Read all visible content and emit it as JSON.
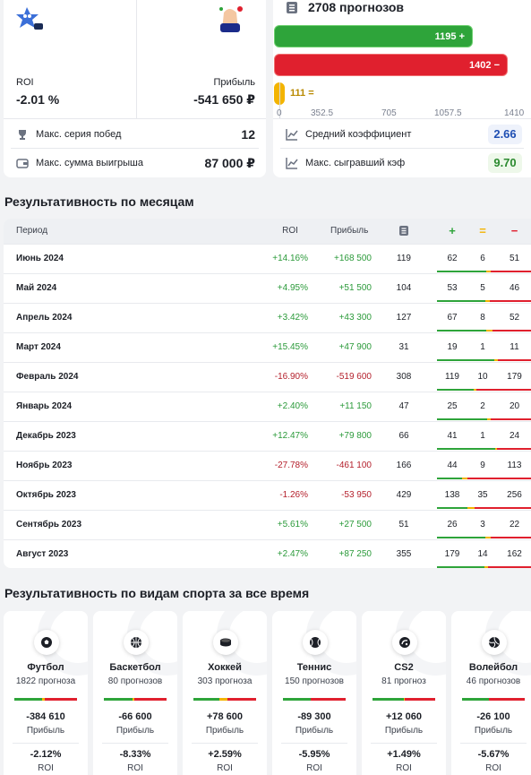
{
  "summary": {
    "roi_label": "ROI",
    "roi_value": "-2.01 %",
    "profit_label": "Прибыль",
    "profit_value": "-541 650 ₽",
    "max_win_streak_label": "Макс. серия побед",
    "max_win_streak_value": "12",
    "max_win_sum_label": "Макс. сумма выигрыша",
    "max_win_sum_value": "87 000 ₽"
  },
  "forecasts": {
    "title": "2708 прогнозов",
    "wins": "1195",
    "wins_sign": "+",
    "losses": "1402",
    "losses_sign": "−",
    "draws": "111",
    "draws_sign": "=",
    "scale_max": 1410,
    "ticks": [
      "0",
      "352.5",
      "705",
      "1057.5",
      "1410"
    ],
    "avg_coef_label": "Средний коэффициент",
    "avg_coef_value": "2.66",
    "max_coef_label": "Макс. сыгравший кэф",
    "max_coef_value": "9.70"
  },
  "months": {
    "title": "Результативность по месяцам",
    "headers": {
      "period": "Период",
      "roi": "ROI",
      "profit": "Прибыль"
    },
    "rows": [
      {
        "period": "Июнь 2024",
        "roi": "+14.16%",
        "profit": "+168 500",
        "n": "119",
        "w": "62",
        "d": "6",
        "l": "51",
        "positive": true
      },
      {
        "period": "Май 2024",
        "roi": "+4.95%",
        "profit": "+51 500",
        "n": "104",
        "w": "53",
        "d": "5",
        "l": "46",
        "positive": true
      },
      {
        "period": "Апрель 2024",
        "roi": "+3.42%",
        "profit": "+43 300",
        "n": "127",
        "w": "67",
        "d": "8",
        "l": "52",
        "positive": true
      },
      {
        "period": "Март 2024",
        "roi": "+15.45%",
        "profit": "+47 900",
        "n": "31",
        "w": "19",
        "d": "1",
        "l": "11",
        "positive": true
      },
      {
        "period": "Февраль 2024",
        "roi": "-16.90%",
        "profit": "-519 600",
        "n": "308",
        "w": "119",
        "d": "10",
        "l": "179",
        "positive": false
      },
      {
        "period": "Январь 2024",
        "roi": "+2.40%",
        "profit": "+11 150",
        "n": "47",
        "w": "25",
        "d": "2",
        "l": "20",
        "positive": true
      },
      {
        "period": "Декабрь 2023",
        "roi": "+12.47%",
        "profit": "+79 800",
        "n": "66",
        "w": "41",
        "d": "1",
        "l": "24",
        "positive": true
      },
      {
        "period": "Ноябрь 2023",
        "roi": "-27.78%",
        "profit": "-461 100",
        "n": "166",
        "w": "44",
        "d": "9",
        "l": "113",
        "positive": false
      },
      {
        "period": "Октябрь 2023",
        "roi": "-1.26%",
        "profit": "-53 950",
        "n": "429",
        "w": "138",
        "d": "35",
        "l": "256",
        "positive": false
      },
      {
        "period": "Сентябрь 2023",
        "roi": "+5.61%",
        "profit": "+27 500",
        "n": "51",
        "w": "26",
        "d": "3",
        "l": "22",
        "positive": true
      },
      {
        "period": "Август 2023",
        "roi": "+2.47%",
        "profit": "+87 250",
        "n": "355",
        "w": "179",
        "d": "14",
        "l": "162",
        "positive": true
      }
    ]
  },
  "sports": {
    "title": "Результативность по видам спорта за все время",
    "profit_label": "Прибыль",
    "roi_label": "ROI",
    "items": [
      {
        "name": "Футбол",
        "count": "1822 прогноза",
        "profit": "-384 610",
        "roi": "-2.12%",
        "icon": "football-icon",
        "split": [
          0.44,
          0.04,
          0.52
        ]
      },
      {
        "name": "Баскетбол",
        "count": "80 прогнозов",
        "profit": "-66 600",
        "roi": "-8.33%",
        "icon": "basketball-icon",
        "split": [
          0.45,
          0.03,
          0.52
        ]
      },
      {
        "name": "Хоккей",
        "count": "303 прогноза",
        "profit": "+78 600",
        "roi": "+2.59%",
        "icon": "hockey-puck-icon",
        "split": [
          0.42,
          0.12,
          0.46
        ]
      },
      {
        "name": "Теннис",
        "count": "150 прогнозов",
        "profit": "-89 300",
        "roi": "-5.95%",
        "icon": "tennis-ball-icon",
        "split": [
          0.44,
          0.0,
          0.56
        ]
      },
      {
        "name": "CS2",
        "count": "81 прогноз",
        "profit": "+12 060",
        "roi": "+1.49%",
        "icon": "cs2-icon",
        "split": [
          0.5,
          0.02,
          0.48
        ]
      },
      {
        "name": "Волейбол",
        "count": "46 прогнозов",
        "profit": "-26 100",
        "roi": "-5.67%",
        "icon": "volleyball-icon",
        "split": [
          0.43,
          0.0,
          0.57
        ]
      }
    ]
  },
  "colors": {
    "green": "#2ea43a",
    "red": "#e0202e",
    "yellow": "#f3b400"
  }
}
